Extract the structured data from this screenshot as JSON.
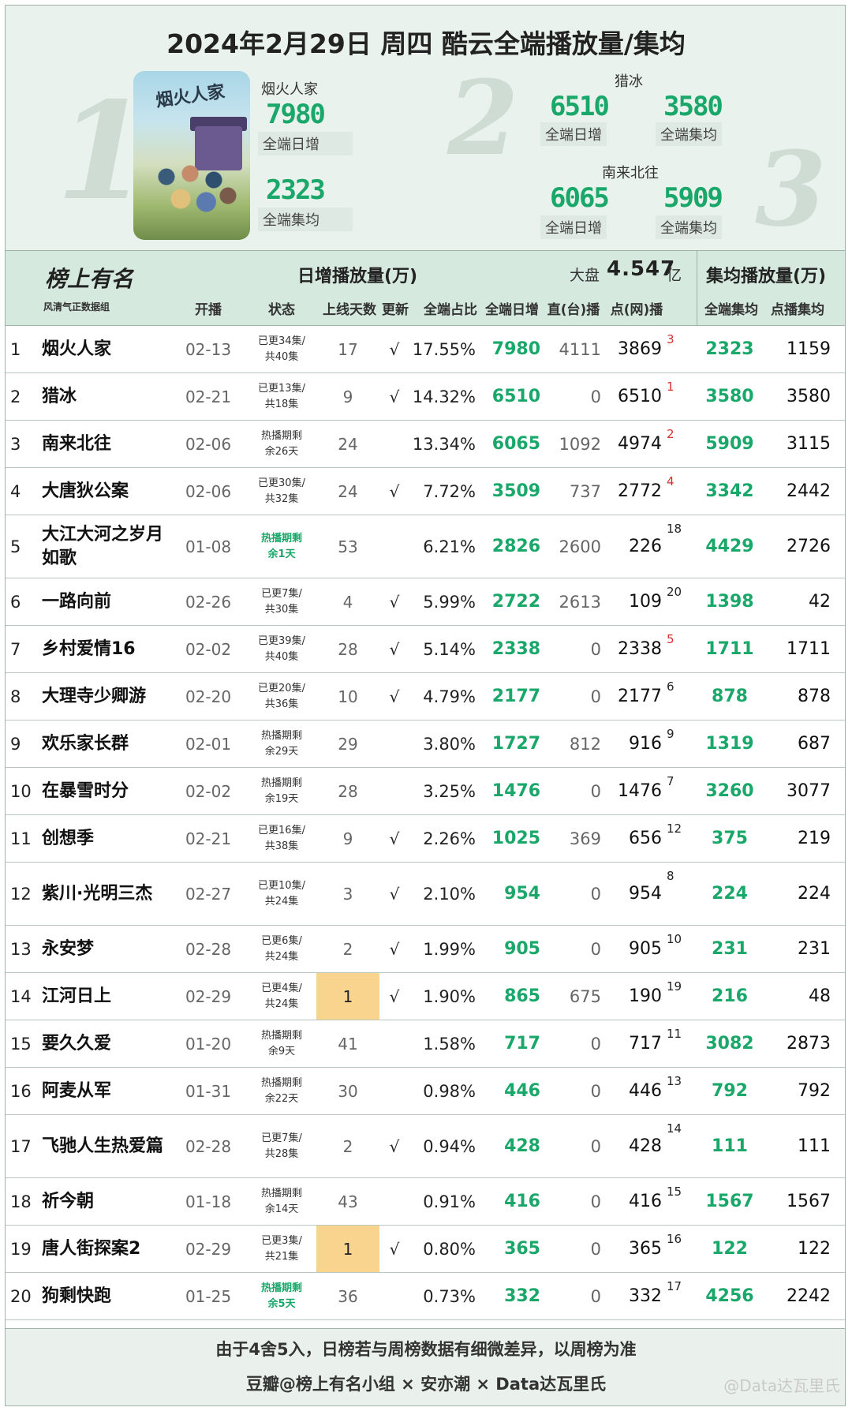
{
  "header": {
    "title": "2024年2月29日 周四  酷云全端播放量/集均",
    "first": {
      "name": "烟火人家",
      "daily": "7980",
      "daily_label": "全端日增",
      "avg": "2323",
      "avg_label": "全端集均",
      "poster_title": "烟火人家"
    },
    "second": {
      "name": "猎冰",
      "daily": "6510",
      "daily_label": "全端日增",
      "avg": "3580",
      "avg_label": "全端集均"
    },
    "third": {
      "name": "南来北往",
      "daily": "6065",
      "daily_label": "全端日增",
      "avg": "5909",
      "avg_label": "全端集均"
    },
    "rank_marks": [
      "1",
      "2",
      "3"
    ]
  },
  "table_header": {
    "logo_title": "榜上有名",
    "logo_sub": "风清气正数据组",
    "group_daily": "日增播放量(万)",
    "group_avg": "集均播放量(万)",
    "dapan_label": "大盘",
    "dapan_value": "4.547",
    "dapan_unit": "亿",
    "cols": {
      "open": "开播",
      "status": "状态",
      "days": "上线天数",
      "upd": "更新",
      "share": "全端占比",
      "daily": "全端日增",
      "tv": "直(台)播",
      "net": "点(网)播",
      "avg": "全端集均",
      "dian": "点播集均"
    }
  },
  "rows": [
    {
      "rank": "1",
      "name": "烟火人家",
      "open": "02-13",
      "status": [
        "已更34集/",
        "共40集"
      ],
      "hot": false,
      "days": "17",
      "new": false,
      "upd": "√",
      "share": "17.55%",
      "daily": "7980",
      "tv": "4111",
      "net": "3869",
      "nrank": "3",
      "nred": true,
      "avg": "2323",
      "dian": "1159"
    },
    {
      "rank": "2",
      "name": "猎冰",
      "open": "02-21",
      "status": [
        "已更13集/",
        "共18集"
      ],
      "hot": false,
      "days": "9",
      "new": false,
      "upd": "√",
      "share": "14.32%",
      "daily": "6510",
      "tv": "0",
      "net": "6510",
      "nrank": "1",
      "nred": true,
      "avg": "3580",
      "dian": "3580"
    },
    {
      "rank": "3",
      "name": "南来北往",
      "open": "02-06",
      "status": [
        "热播期剩",
        "余26天"
      ],
      "hot": false,
      "days": "24",
      "new": false,
      "upd": "",
      "share": "13.34%",
      "daily": "6065",
      "tv": "1092",
      "net": "4974",
      "nrank": "2",
      "nred": true,
      "avg": "5909",
      "dian": "3115"
    },
    {
      "rank": "4",
      "name": "大唐狄公案",
      "open": "02-06",
      "status": [
        "已更30集/",
        "共32集"
      ],
      "hot": false,
      "days": "24",
      "new": false,
      "upd": "√",
      "share": "7.72%",
      "daily": "3509",
      "tv": "737",
      "net": "2772",
      "nrank": "4",
      "nred": true,
      "avg": "3342",
      "dian": "2442"
    },
    {
      "rank": "5",
      "name": "大江大河之岁月如歌",
      "open": "01-08",
      "status": [
        "热播期剩",
        "余1天"
      ],
      "hot": true,
      "days": "53",
      "new": false,
      "upd": "",
      "share": "6.21%",
      "daily": "2826",
      "tv": "2600",
      "net": "226",
      "nrank": "18",
      "nred": false,
      "avg": "4429",
      "dian": "2726"
    },
    {
      "rank": "6",
      "name": "一路向前",
      "open": "02-26",
      "status": [
        "已更7集/",
        "共30集"
      ],
      "hot": false,
      "days": "4",
      "new": false,
      "upd": "√",
      "share": "5.99%",
      "daily": "2722",
      "tv": "2613",
      "net": "109",
      "nrank": "20",
      "nred": false,
      "avg": "1398",
      "dian": "42"
    },
    {
      "rank": "7",
      "name": "乡村爱情16",
      "open": "02-02",
      "status": [
        "已更39集/",
        "共40集"
      ],
      "hot": false,
      "days": "28",
      "new": false,
      "upd": "√",
      "share": "5.14%",
      "daily": "2338",
      "tv": "0",
      "net": "2338",
      "nrank": "5",
      "nred": true,
      "avg": "1711",
      "dian": "1711"
    },
    {
      "rank": "8",
      "name": "大理寺少卿游",
      "open": "02-20",
      "status": [
        "已更20集/",
        "共36集"
      ],
      "hot": false,
      "days": "10",
      "new": false,
      "upd": "√",
      "share": "4.79%",
      "daily": "2177",
      "tv": "0",
      "net": "2177",
      "nrank": "6",
      "nred": false,
      "avg": "878",
      "dian": "878"
    },
    {
      "rank": "9",
      "name": "欢乐家长群",
      "open": "02-01",
      "status": [
        "热播期剩",
        "余29天"
      ],
      "hot": false,
      "days": "29",
      "new": false,
      "upd": "",
      "share": "3.80%",
      "daily": "1727",
      "tv": "812",
      "net": "916",
      "nrank": "9",
      "nred": false,
      "avg": "1319",
      "dian": "687"
    },
    {
      "rank": "10",
      "name": "在暴雪时分",
      "open": "02-02",
      "status": [
        "热播期剩",
        "余19天"
      ],
      "hot": false,
      "days": "28",
      "new": false,
      "upd": "",
      "share": "3.25%",
      "daily": "1476",
      "tv": "0",
      "net": "1476",
      "nrank": "7",
      "nred": false,
      "avg": "3260",
      "dian": "3077"
    },
    {
      "rank": "11",
      "name": "创想季",
      "open": "02-21",
      "status": [
        "已更16集/",
        "共38集"
      ],
      "hot": false,
      "days": "9",
      "new": false,
      "upd": "√",
      "share": "2.26%",
      "daily": "1025",
      "tv": "369",
      "net": "656",
      "nrank": "12",
      "nred": false,
      "avg": "375",
      "dian": "219"
    },
    {
      "rank": "12",
      "name": "紫川·光明三杰",
      "open": "02-27",
      "status": [
        "已更10集/",
        "共24集"
      ],
      "hot": false,
      "days": "3",
      "new": false,
      "upd": "√",
      "share": "2.10%",
      "daily": "954",
      "tv": "0",
      "net": "954",
      "nrank": "8",
      "nred": false,
      "avg": "224",
      "dian": "224"
    },
    {
      "rank": "13",
      "name": "永安梦",
      "open": "02-28",
      "status": [
        "已更6集/",
        "共24集"
      ],
      "hot": false,
      "days": "2",
      "new": false,
      "upd": "√",
      "share": "1.99%",
      "daily": "905",
      "tv": "0",
      "net": "905",
      "nrank": "10",
      "nred": false,
      "avg": "231",
      "dian": "231"
    },
    {
      "rank": "14",
      "name": "江河日上",
      "open": "02-29",
      "status": [
        "已更4集/",
        "共24集"
      ],
      "hot": false,
      "days": "1",
      "new": true,
      "upd": "√",
      "share": "1.90%",
      "daily": "865",
      "tv": "675",
      "net": "190",
      "nrank": "19",
      "nred": false,
      "avg": "216",
      "dian": "48"
    },
    {
      "rank": "15",
      "name": "要久久爱",
      "open": "01-20",
      "status": [
        "热播期剩",
        "余9天"
      ],
      "hot": false,
      "days": "41",
      "new": false,
      "upd": "",
      "share": "1.58%",
      "daily": "717",
      "tv": "0",
      "net": "717",
      "nrank": "11",
      "nred": false,
      "avg": "3082",
      "dian": "2873"
    },
    {
      "rank": "16",
      "name": "阿麦从军",
      "open": "01-31",
      "status": [
        "热播期剩",
        "余22天"
      ],
      "hot": false,
      "days": "30",
      "new": false,
      "upd": "",
      "share": "0.98%",
      "daily": "446",
      "tv": "0",
      "net": "446",
      "nrank": "13",
      "nred": false,
      "avg": "792",
      "dian": "792"
    },
    {
      "rank": "17",
      "name": "飞驰人生热爱篇",
      "open": "02-28",
      "status": [
        "已更7集/",
        "共28集"
      ],
      "hot": false,
      "days": "2",
      "new": false,
      "upd": "√",
      "share": "0.94%",
      "daily": "428",
      "tv": "0",
      "net": "428",
      "nrank": "14",
      "nred": false,
      "avg": "111",
      "dian": "111"
    },
    {
      "rank": "18",
      "name": "祈今朝",
      "open": "01-18",
      "status": [
        "热播期剩",
        "余14天"
      ],
      "hot": false,
      "days": "43",
      "new": false,
      "upd": "",
      "share": "0.91%",
      "daily": "416",
      "tv": "0",
      "net": "416",
      "nrank": "15",
      "nred": false,
      "avg": "1567",
      "dian": "1567"
    },
    {
      "rank": "19",
      "name": "唐人街探案2",
      "open": "02-29",
      "status": [
        "已更3集/",
        "共21集"
      ],
      "hot": false,
      "days": "1",
      "new": true,
      "upd": "√",
      "share": "0.80%",
      "daily": "365",
      "tv": "0",
      "net": "365",
      "nrank": "16",
      "nred": false,
      "avg": "122",
      "dian": "122"
    },
    {
      "rank": "20",
      "name": "狗剩快跑",
      "open": "01-25",
      "status": [
        "热播期剩",
        "余5天"
      ],
      "hot": true,
      "days": "36",
      "new": false,
      "upd": "",
      "share": "0.73%",
      "daily": "332",
      "tv": "0",
      "net": "332",
      "nrank": "17",
      "nred": false,
      "avg": "4256",
      "dian": "2242"
    }
  ],
  "footer": {
    "note": "由于4舍5入，日榜若与周榜数据有细微差异，以周榜为准",
    "credits": "豆瓣@榜上有名小组 × 安亦潮 × Data达瓦里氏",
    "weibo": "@Data达瓦里氏"
  },
  "colors": {
    "accent_green": "#1aa76a",
    "header_bg": "#e9f2ec",
    "new_highlight": "#f9d48e",
    "rank_red": "#d63030"
  }
}
